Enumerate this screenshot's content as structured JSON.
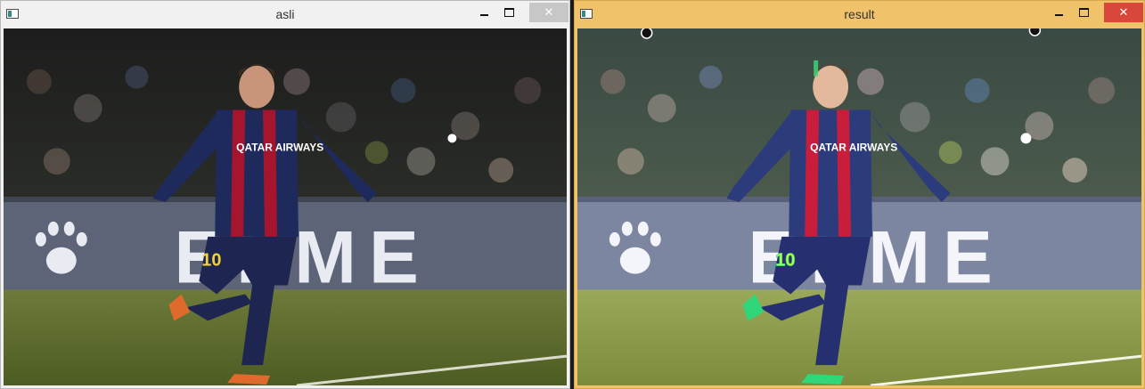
{
  "windows": [
    {
      "id": "asli",
      "title": "asli",
      "controls": {
        "minimize": "–",
        "maximize": "□",
        "close": "✕"
      }
    },
    {
      "id": "result",
      "title": "result",
      "controls": {
        "minimize": "–",
        "maximize": "□",
        "close": "✕"
      }
    }
  ],
  "scene": {
    "board_text": "ELME",
    "shirt_sponsor": "QATAR AIRWAYS",
    "shorts_number": "10"
  },
  "colors": {
    "active_titlebar": "#f0c26a",
    "inactive_titlebar": "#f1f1f1",
    "close_active": "#d9473a",
    "highlight_green": "#39e07a"
  }
}
